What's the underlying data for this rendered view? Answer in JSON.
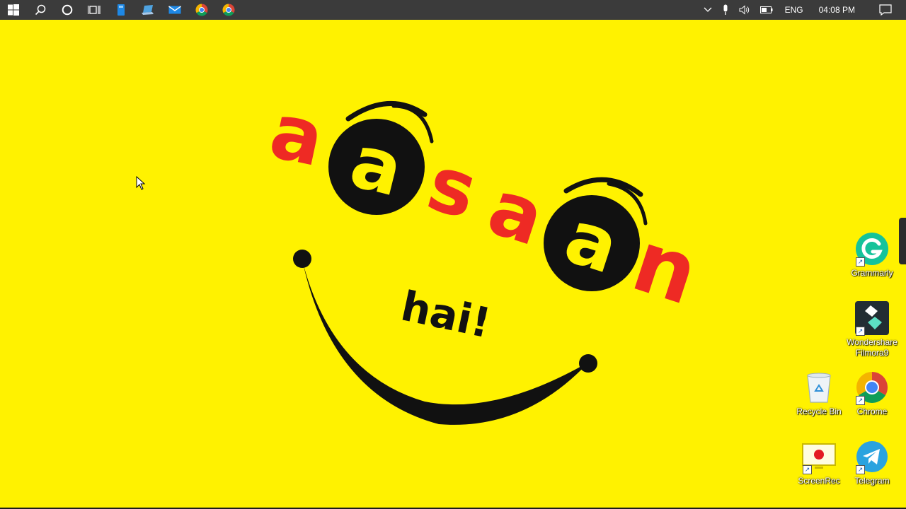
{
  "taskbar": {
    "apps": [
      {
        "name": "start-button"
      },
      {
        "name": "search-button"
      },
      {
        "name": "cortana-button"
      },
      {
        "name": "task-view-button"
      },
      {
        "name": "app-files"
      },
      {
        "name": "app-laptop"
      },
      {
        "name": "app-mail"
      },
      {
        "name": "app-chrome-1"
      },
      {
        "name": "app-chrome-2"
      }
    ],
    "tray": {
      "language": "ENG",
      "time": "04:08 PM"
    }
  },
  "wallpaper": {
    "brand_word": "aasaan",
    "sub_word": "hai!",
    "colors": {
      "background": "#fff200",
      "red": "#ee2a24",
      "black": "#111111"
    }
  },
  "desktop_icons": [
    {
      "label": "Grammarly",
      "icon": "grammarly-icon"
    },
    {
      "label": "Wondershare Filmora9",
      "icon": "filmora-icon"
    },
    {
      "label": "Recycle Bin",
      "icon": "recycle-bin-icon"
    },
    {
      "label": "Chrome",
      "icon": "chrome-icon"
    },
    {
      "label": "ScreenRec",
      "icon": "screenrec-icon"
    },
    {
      "label": "Telegram",
      "icon": "telegram-icon"
    }
  ]
}
